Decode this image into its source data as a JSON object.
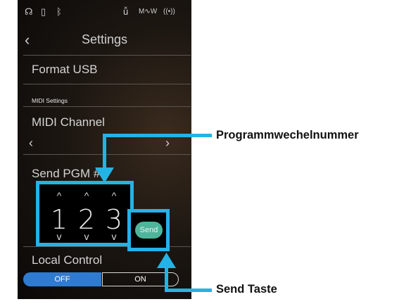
{
  "statusbar": {
    "icons": [
      "headphones-icon",
      "usb-icon",
      "bluetooth-icon",
      "microphone-icon",
      "sound-wave-icon",
      "wireless-icon"
    ],
    "headphones_glyph": "☊",
    "usb_glyph": "▯",
    "bluetooth_glyph": "ᛒ",
    "mic_glyph": "ǚ",
    "wave_glyph": "M∿W",
    "wireless_glyph": "((•))"
  },
  "header": {
    "back_glyph": "‹",
    "title": "Settings"
  },
  "rows": {
    "format_usb": "Format USB",
    "midi_section": "MIDI Settings",
    "midi_channel": "MIDI Channel",
    "left_arrow": "‹",
    "right_arrow": "›",
    "send_pgm": "Send PGM #",
    "local_control": "Local Control"
  },
  "pgm_digits": {
    "d1": "1",
    "d2": "2",
    "d3": "3",
    "up": "^",
    "down": "v"
  },
  "send_button": {
    "label": "Send"
  },
  "local_toggle": {
    "off_label": "OFF",
    "on_label": "ON",
    "selected": "OFF"
  },
  "callouts": {
    "program_change": "Programmwechelnummer",
    "send_key": "Send Taste"
  },
  "colors": {
    "highlight": "#24b3e5",
    "send_button": "#4eb59b",
    "toggle_selected": "#2f7bd1"
  }
}
